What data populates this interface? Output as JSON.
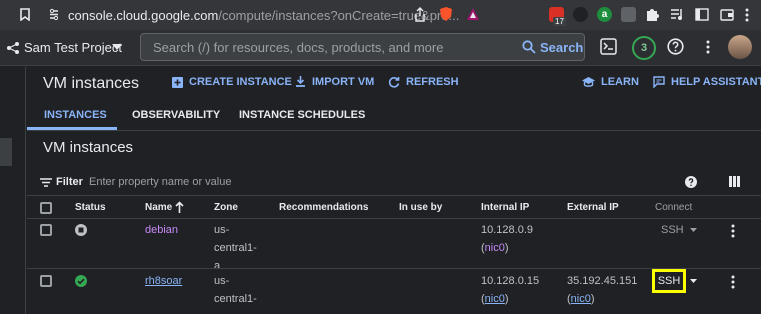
{
  "browser": {
    "url_host": "console.cloud.google.com",
    "url_path": "/compute/instances?onCreate=true&pro...",
    "ext_badge": "17"
  },
  "header": {
    "project_name": "Sam Test Project",
    "search_placeholder": "Search (/) for resources, docs, products, and more",
    "search_button": "Search",
    "notification_count": "3"
  },
  "toolbar": {
    "title": "VM instances",
    "create_instance": "CREATE INSTANCE",
    "import_vm": "IMPORT VM",
    "refresh": "REFRESH",
    "learn": "LEARN",
    "help_assistant": "HELP ASSISTANT"
  },
  "tabs": [
    "INSTANCES",
    "OBSERVABILITY",
    "INSTANCE SCHEDULES"
  ],
  "section_title": "VM instances",
  "filter": {
    "label": "Filter",
    "placeholder": "Enter property name or value"
  },
  "table": {
    "columns": [
      "Status",
      "Name",
      "Zone",
      "Recommendations",
      "In use by",
      "Internal IP",
      "External IP",
      "Connect"
    ],
    "rows": [
      {
        "status": "stopped",
        "name": "debian",
        "zone": [
          "us-",
          "central1-",
          "a"
        ],
        "internal_ip": "10.128.0.9",
        "internal_nic": "nic0",
        "external_ip": "",
        "external_nic": "",
        "connect": "SSH"
      },
      {
        "status": "running",
        "name": "rh8soar",
        "zone": [
          "us-",
          "central1-",
          "a"
        ],
        "internal_ip": "10.128.0.15",
        "internal_nic": "nic0",
        "external_ip": "35.192.45.151",
        "external_nic": "nic0",
        "connect": "SSH"
      }
    ]
  },
  "colors": {
    "accent": "#8ab4f8",
    "running": "#34a853",
    "highlight": "#fbff00"
  }
}
